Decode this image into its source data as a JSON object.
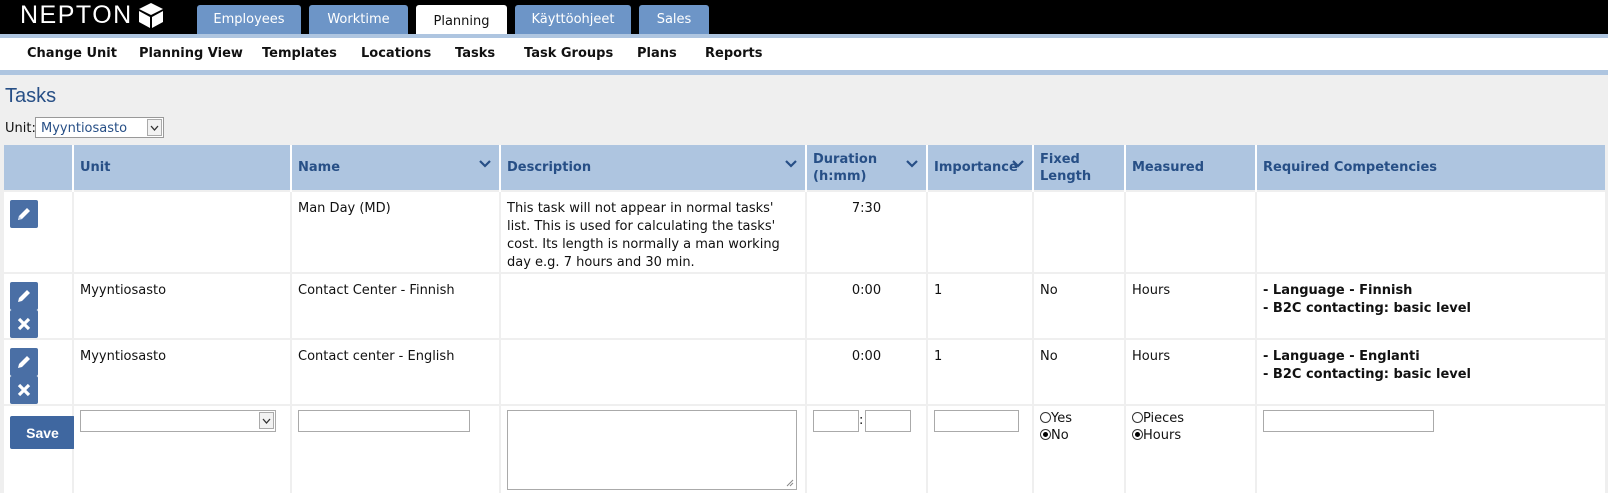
{
  "brand": {
    "logo_text": "NEPTON"
  },
  "main_tabs": [
    {
      "label": "Employees"
    },
    {
      "label": "Worktime"
    },
    {
      "label": "Planning"
    },
    {
      "label": "Käyttöohjeet"
    },
    {
      "label": "Sales"
    }
  ],
  "active_main_tab": "Planning",
  "subnav": [
    {
      "label": "Change Unit"
    },
    {
      "label": "Planning View"
    },
    {
      "label": "Templates"
    },
    {
      "label": "Locations"
    },
    {
      "label": "Tasks"
    },
    {
      "label": "Task Groups"
    },
    {
      "label": "Plans"
    },
    {
      "label": "Reports"
    }
  ],
  "page": {
    "title": "Tasks",
    "unit_label": "Unit:",
    "unit_selected": "Myyntiosasto"
  },
  "table": {
    "headers": {
      "unit": "Unit",
      "name": "Name",
      "description": "Description",
      "duration_line1": "Duration",
      "duration_line2": "(h:mm)",
      "importance": "Importance",
      "fixed_line1": "Fixed",
      "fixed_line2": "Length",
      "measured": "Measured",
      "competencies": "Required Competencies"
    },
    "rows": [
      {
        "unit": "",
        "name": "Man Day (MD)",
        "description": "This task will not appear in normal tasks' list. This is used for calculating the tasks' cost. Its length is normally a man working day e.g. 7 hours and 30 min.",
        "duration": "7:30",
        "importance": "",
        "fixed": "",
        "measured": "",
        "competencies": []
      },
      {
        "unit": "Myyntiosasto",
        "name": "Contact Center - Finnish",
        "description": "",
        "duration": "0:00",
        "importance": "1",
        "fixed": "No",
        "measured": "Hours",
        "competencies": [
          "- Language - Finnish",
          "- B2C contacting: basic level"
        ]
      },
      {
        "unit": "Myyntiosasto",
        "name": "Contact center - English",
        "description": "",
        "duration": "0:00",
        "importance": "1",
        "fixed": "No",
        "measured": "Hours",
        "competencies": [
          "- Language - Englanti",
          "- B2C contacting: basic level"
        ]
      }
    ],
    "new_row": {
      "save_label": "Save",
      "duration_separator": ":",
      "fixed_options": [
        "Yes",
        "No"
      ],
      "fixed_selected": "No",
      "measured_options": [
        "Pieces",
        "Hours"
      ],
      "measured_selected": "Hours"
    }
  },
  "colors": {
    "topbar": "#000000",
    "tab": "#6d95c7",
    "header": "#aec5e0",
    "title": "#274f86",
    "button": "#4a6fa5"
  }
}
